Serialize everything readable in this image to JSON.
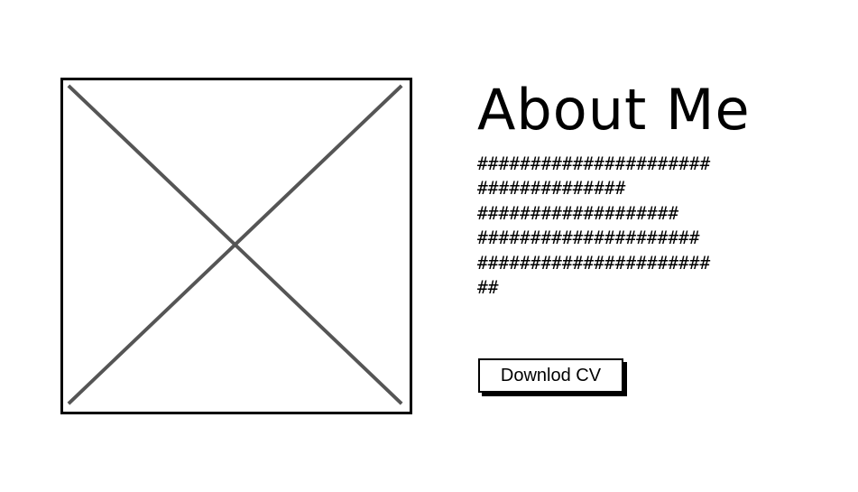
{
  "about": {
    "title": "About Me",
    "body_lines": [
      "######################",
      "##############",
      "###################",
      "#####################",
      "######################",
      "##"
    ]
  },
  "image": {
    "icon": "image-placeholder-icon",
    "border_color": "#000000",
    "cross_color": "#555555"
  },
  "actions": {
    "download_label": "Downlod CV"
  }
}
